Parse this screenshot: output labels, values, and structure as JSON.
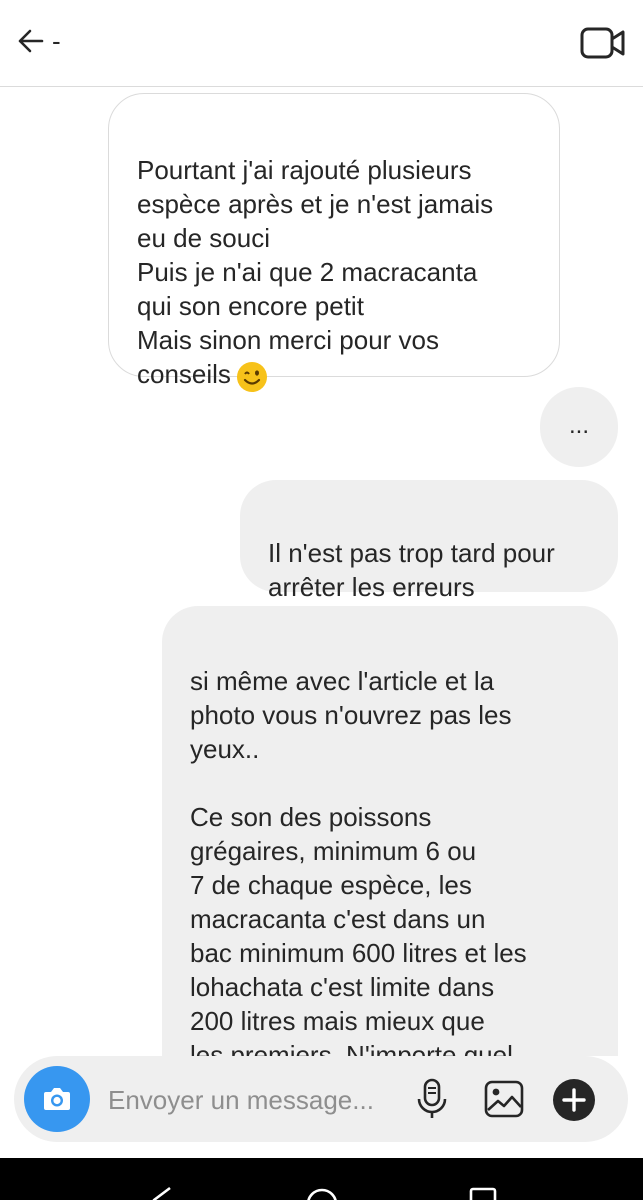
{
  "header": {
    "contact_name": "-",
    "back_icon": "arrow-left-icon",
    "video_icon": "video-camera-icon"
  },
  "messages": [
    {
      "direction": "incoming",
      "text": "Pourtant j'ai rajouté plusieurs\nespèce après et je n'est jamais\neu de souci\nPuis je n'ai que 2 macracanta\nqui son encore petit\nMais sinon merci pour vos\nconseils",
      "emoji": "winking-face"
    },
    {
      "direction": "typing",
      "text": "..."
    },
    {
      "direction": "outgoing",
      "text": "Il n'est pas trop tard pour\narrêter les erreurs"
    },
    {
      "direction": "outgoing",
      "text": "si même avec l'article et la\nphoto vous n'ouvrez pas les\nyeux..\n\n Ce son des poissons\ngrégaires, minimum  6 ou\n7 de chaque espèce, les\nmacracanta c'est dans un\nbac minimum 600 litres et les\nlohachata c'est limite dans\n200 litres mais mieux que\nles premiers. N'importe quel\naquariophile vous le dira, vous"
    }
  ],
  "composer": {
    "placeholder": "Envoyer un message...",
    "value": "",
    "camera_icon": "camera-icon",
    "mic_icon": "microphone-icon",
    "gallery_icon": "image-icon",
    "add_icon": "plus-circle-icon",
    "accent_color": "#3797f0"
  },
  "navbar": {
    "icons": [
      "nav-back-icon",
      "nav-home-icon",
      "nav-recent-icon"
    ]
  },
  "colors": {
    "outgoing_bubble": "#efefef",
    "incoming_border": "#dbdbdb",
    "text": "#262626"
  }
}
